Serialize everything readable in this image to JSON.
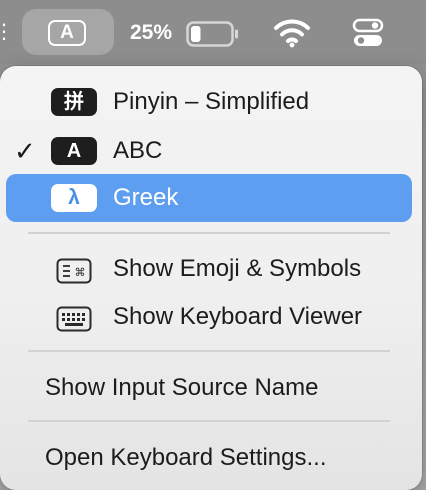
{
  "menubar": {
    "input_source_badge": "A",
    "battery_percent": "25%",
    "battery_level": 0.25,
    "icons": [
      "input-source-icon",
      "battery-icon",
      "wifi-icon",
      "control-center-icon"
    ]
  },
  "menu": {
    "input_sources": [
      {
        "badge": "拼",
        "label": "Pinyin – Simplified",
        "checked": false,
        "selected": false
      },
      {
        "badge": "A",
        "label": "ABC",
        "checked": true,
        "selected": false
      },
      {
        "badge": "λ",
        "label": "Greek",
        "checked": false,
        "selected": true
      }
    ],
    "check_mark": "✓",
    "tools": [
      {
        "icon": "emoji-symbols-icon",
        "label": "Show Emoji & Symbols"
      },
      {
        "icon": "keyboard-viewer-icon",
        "label": "Show Keyboard Viewer"
      }
    ],
    "show_input_source_name": "Show Input Source Name",
    "open_keyboard_settings": "Open Keyboard Settings..."
  },
  "colors": {
    "selection": "#5d9ef0",
    "menubar": "#8d8d8d",
    "menu_background": "#f0f0f0"
  }
}
